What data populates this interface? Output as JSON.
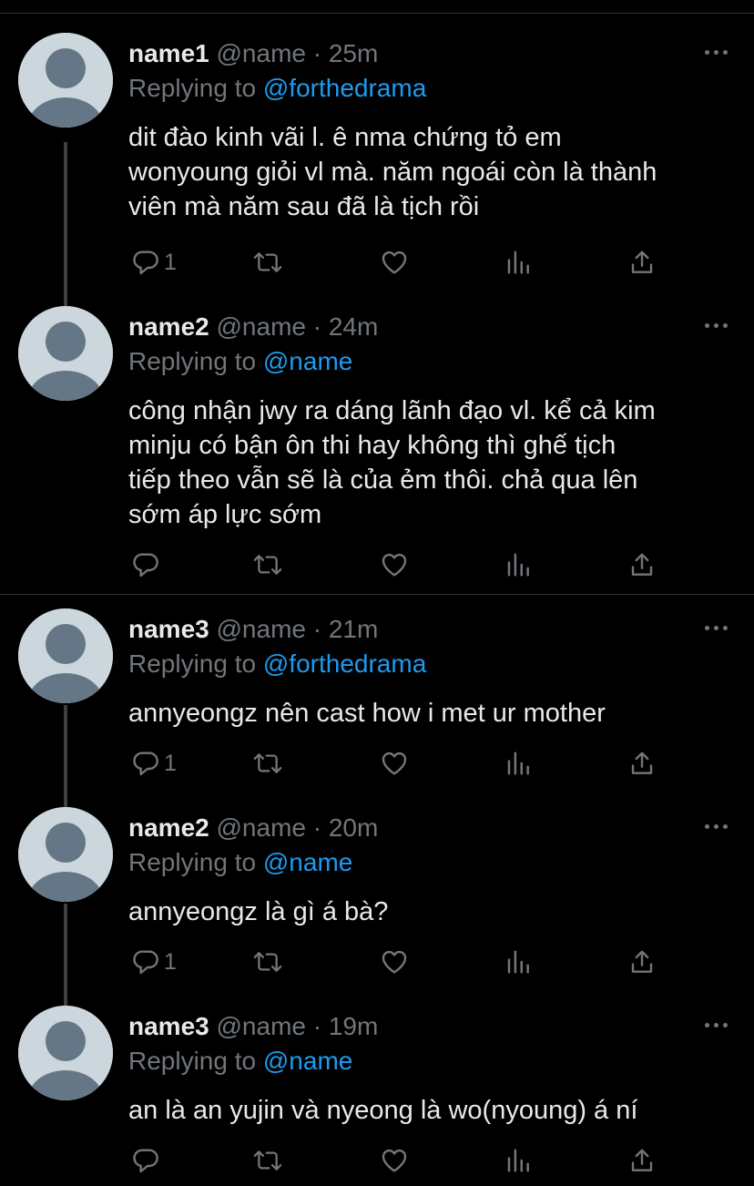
{
  "tweets": [
    {
      "name": "name1",
      "handle": "@name",
      "dot": "·",
      "time": "25m",
      "replying_prefix": "Replying to",
      "replying_to": "@forthedrama",
      "lines": [
        "dit đào kinh vãi l. ê nma chứng tỏ em",
        "wonyoung giỏi vl mà. năm ngoái còn là thành",
        "viên mà năm sau đã là tịch rồi"
      ],
      "reply_count": "1"
    },
    {
      "name": "name2",
      "handle": "@name",
      "dot": "·",
      "time": "24m",
      "replying_prefix": "Replying to",
      "replying_to": "@name",
      "lines": [
        "công nhận jwy ra dáng lãnh đạo vl. kể cả kim",
        "minju có bận ôn thi hay không thì ghế tịch",
        "tiếp theo vẫn sẽ là của ẻm thôi. chả qua lên",
        "sớm áp lực sớm"
      ],
      "reply_count": ""
    },
    {
      "name": "name3",
      "handle": "@name",
      "dot": "·",
      "time": "21m",
      "replying_prefix": "Replying to",
      "replying_to": "@forthedrama",
      "lines": [
        "annyeongz nên cast how i met ur mother"
      ],
      "reply_count": "1"
    },
    {
      "name": "name2",
      "handle": "@name",
      "dot": "·",
      "time": "20m",
      "replying_prefix": "Replying to",
      "replying_to": "@name",
      "lines": [
        "annyeongz là gì á bà?"
      ],
      "reply_count": "1"
    },
    {
      "name": "name3",
      "handle": "@name",
      "dot": "·",
      "time": "19m",
      "replying_prefix": "Replying to",
      "replying_to": "@name",
      "lines": [
        "an là an yujin và nyeong là wo(nyoung) á ní"
      ],
      "reply_count": ""
    }
  ],
  "icons": {
    "reply": "reply-icon",
    "retweet": "retweet-icon",
    "like": "like-icon",
    "analytics": "analytics-icon",
    "share": "share-icon",
    "more": "more-icon",
    "avatar": "default-avatar-icon"
  },
  "colors": {
    "background": "#000000",
    "text": "#e7e9ea",
    "secondary": "#71767b",
    "link": "#1d9bf0",
    "avatar_bg": "#ccd6dd",
    "avatar_fg": "#657786"
  }
}
